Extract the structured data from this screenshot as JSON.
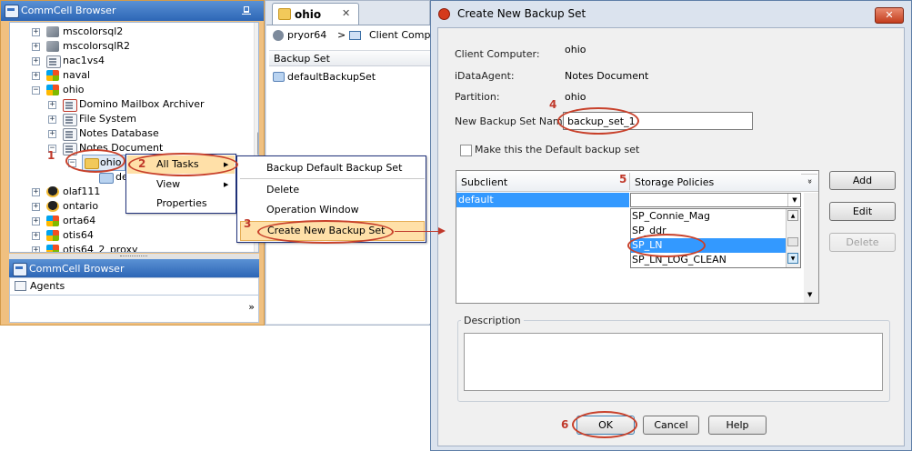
{
  "left_panel": {
    "header": "CommCell Browser",
    "pin": "ᵖ",
    "tree": [
      {
        "label": "mscolorsql2"
      },
      {
        "label": "mscolorsqlR2"
      },
      {
        "label": "nac1vs4"
      },
      {
        "label": "naval"
      },
      {
        "label": "ohio"
      },
      {
        "label": "Domino Mailbox Archiver"
      },
      {
        "label": "File System"
      },
      {
        "label": "Notes Database"
      },
      {
        "label": "Notes Document"
      },
      {
        "label": "ohio"
      },
      {
        "label": "de"
      },
      {
        "label": "olaf111"
      },
      {
        "label": "ontario"
      },
      {
        "label": "orta64"
      },
      {
        "label": "otis64"
      },
      {
        "label": "otis64_2_proxy"
      }
    ],
    "header2": "CommCell Browser",
    "agents_label": "Agents",
    "more_glyph": "»"
  },
  "middle_panel": {
    "tab_label": "ohio",
    "tab_close": "✕",
    "crumb_client": "pryor64",
    "crumb_sep": ">",
    "crumb_next": "Client Comput",
    "column_header": "Backup Set",
    "row": "defaultBackupSet"
  },
  "context_menu": {
    "items": [
      "All Tasks",
      "View",
      "Properties"
    ]
  },
  "submenu": {
    "items": [
      "Backup Default Backup Set",
      "Delete",
      "Operation Window",
      "Create New Backup Set"
    ]
  },
  "dialog": {
    "title": "Create New Backup Set",
    "close_glyph": "✕",
    "client_label": "Client Computer:",
    "client_value": "ohio",
    "agent_label": "iDataAgent:",
    "agent_value": "Notes Document",
    "partition_label": "Partition:",
    "partition_value": "ohio",
    "name_label": "New Backup Set Name:",
    "name_value": "backup_set_1",
    "default_checkbox_label": "Make this the Default backup set",
    "grid_headers": [
      "Subclient",
      "Storage Policies"
    ],
    "sort_glyph": "»",
    "subclient": "default",
    "policies": [
      "SP_Connie_Mag",
      "SP_ddr",
      "SP_LN",
      "SP_LN_LOG_CLEAN"
    ],
    "selected_policy_index": 2,
    "side_buttons": [
      "Add",
      "Edit",
      "Delete"
    ],
    "description_label": "Description",
    "ok": "OK",
    "cancel": "Cancel",
    "help": "Help"
  },
  "annotations": [
    "1",
    "2",
    "3",
    "4",
    "5",
    "6"
  ],
  "colors": {
    "accent_orange": "#f0c080",
    "selection_blue": "#3399ff",
    "annotation_red": "#c0392b"
  }
}
